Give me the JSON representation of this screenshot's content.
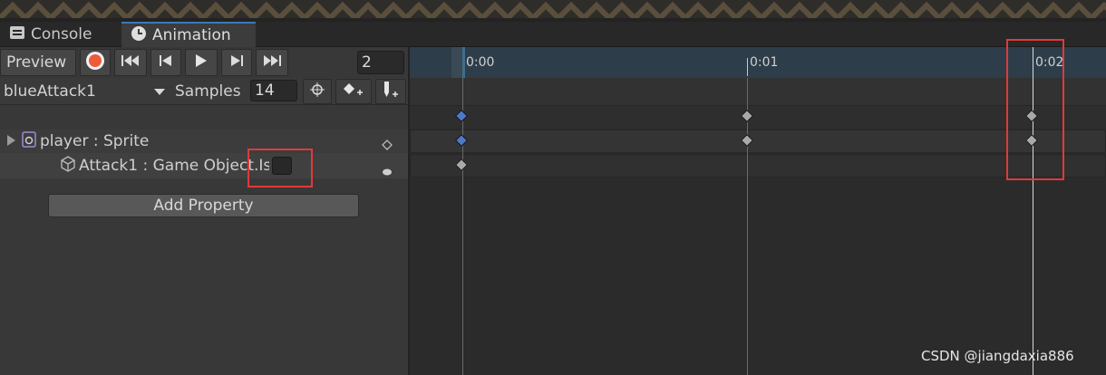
{
  "tabs": [
    {
      "label": "Console",
      "icon": "console-icon"
    },
    {
      "label": "Animation",
      "icon": "clock-icon"
    }
  ],
  "toolbar": {
    "preview_label": "Preview",
    "frame_value": "2",
    "clip_name": "blueAttack1",
    "samples_label": "Samples",
    "samples_value": "14"
  },
  "properties": [
    {
      "label": "player : Sprite",
      "icon": "sprite-renderer-icon",
      "expandable": true
    },
    {
      "label": "Attack1 : Game Object.Is",
      "icon": "gameobject-cube-icon",
      "expandable": false
    }
  ],
  "add_property_label": "Add Property",
  "timeline": {
    "ticks": [
      "0:00",
      "0:01",
      "0:02"
    ]
  },
  "watermark": "CSDN @jiangdaxia886",
  "colors": {
    "record": "#ef5a3a",
    "accent": "#3a79bb",
    "key_selected": "#4f79c6",
    "highlight_box": "#e03a3a"
  }
}
